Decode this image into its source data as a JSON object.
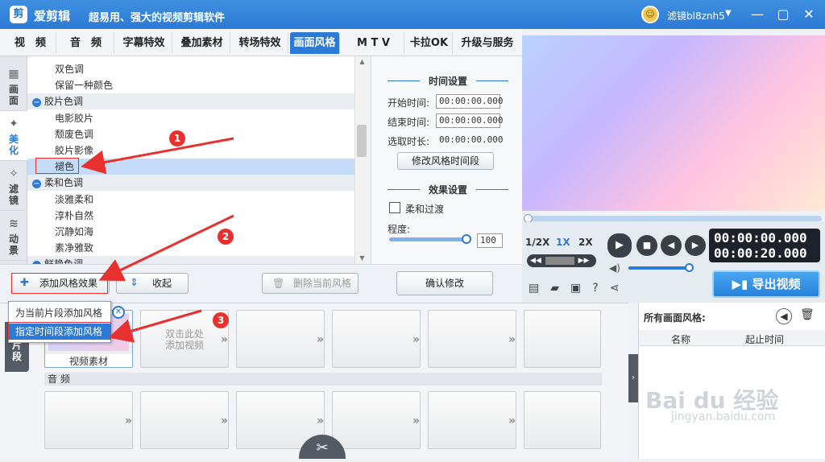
{
  "app": {
    "logo_char": "剪",
    "name": "爱剪辑",
    "slogan": "超易用、强大的视频剪辑软件",
    "user": "滤镜bl8znh5",
    "user_dropdown": "▼"
  },
  "window": {
    "min": "—",
    "restore": "▢",
    "close": "✕"
  },
  "tabs": [
    "视　频",
    "音　频",
    "字幕特效",
    "叠加素材",
    "转场特效",
    "画面风格",
    "M T V",
    "卡拉OK",
    "升级与服务"
  ],
  "active_tab": "画面风格",
  "side_tabs": [
    {
      "label": "画\n面",
      "icon": "▦"
    },
    {
      "label": "美\n化",
      "icon": "✦"
    },
    {
      "label": "滤\n镜",
      "icon": "✧"
    },
    {
      "label": "动\n景",
      "icon": "≋"
    }
  ],
  "style_list": [
    {
      "type": "item",
      "label": "双色调"
    },
    {
      "type": "item",
      "label": "保留一种颜色"
    },
    {
      "type": "cat",
      "label": "胶片色调",
      "toggle": "−"
    },
    {
      "type": "item",
      "label": "电影胶片"
    },
    {
      "type": "item",
      "label": "颓废色调"
    },
    {
      "type": "item",
      "label": "胶片影像"
    },
    {
      "type": "item",
      "label": "褪色",
      "selected": true
    },
    {
      "type": "cat",
      "label": "柔和色调",
      "toggle": "−"
    },
    {
      "type": "item",
      "label": "淡雅柔和"
    },
    {
      "type": "item",
      "label": "淳朴自然"
    },
    {
      "type": "item",
      "label": "沉静如海"
    },
    {
      "type": "item",
      "label": "素净雅致"
    },
    {
      "type": "cat",
      "label": "鲜艳色调",
      "toggle": "−"
    }
  ],
  "time_settings": {
    "title": "时间设置",
    "start_label": "开始时间:",
    "start": "00:00:00.000",
    "end_label": "结束时间:",
    "end": "00:00:00.000",
    "dur_label": "选取时长:",
    "dur": "00:00:00.000",
    "modify_btn": "修改风格时间段"
  },
  "effect_settings": {
    "title": "效果设置",
    "smooth_label": "柔和过渡",
    "degree_label": "程度:",
    "degree_value": "100",
    "degree_fraction": 1.0
  },
  "toolbar": {
    "add_style": "添加风格效果",
    "collapse": "收起",
    "delete_style": "删除当前风格",
    "confirm": "确认修改"
  },
  "dropdown": {
    "opt1": "为当前片段添加风格",
    "opt2": "指定时间段添加风格"
  },
  "player": {
    "speed_half": "1/2X",
    "speed_1": "1X",
    "speed_2": "2X",
    "time_current": "00:00:00.000",
    "time_total": "00:00:20.000",
    "export": "导出视频",
    "progress": 0.0
  },
  "timeline": {
    "side_label": "片\n段",
    "clip_label": "视频素材",
    "add_hint": "双击此处\n添加视频",
    "audio_label": "音 频"
  },
  "side_panel": {
    "title": "所有画面风格:",
    "col_name": "名称",
    "col_time": "起止时间"
  },
  "annotations": [
    "1",
    "2",
    "3"
  ],
  "watermark": {
    "brand": "Bai du 经验",
    "url": "jingyan.baidu.com"
  },
  "colors": {
    "accent": "#2c7ad6",
    "annot": "#e8312f"
  }
}
